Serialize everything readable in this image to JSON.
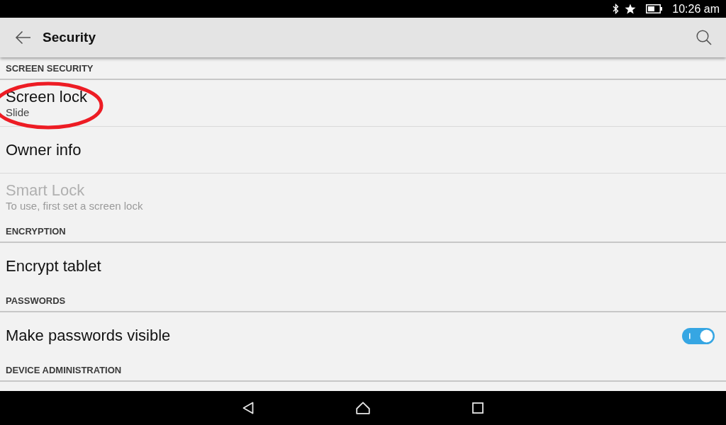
{
  "status_bar": {
    "time": "10:26 am"
  },
  "app_bar": {
    "title": "Security"
  },
  "sections": [
    {
      "title": "SCREEN SECURITY",
      "items": [
        {
          "kind": "text",
          "title": "Screen lock",
          "summary": "Slide",
          "disabled": false,
          "circled": true
        },
        {
          "kind": "text",
          "title": "Owner info",
          "disabled": false,
          "circled": false
        },
        {
          "kind": "text",
          "title": "Smart Lock",
          "summary": "To use, first set a screen lock",
          "disabled": true,
          "circled": false
        }
      ]
    },
    {
      "title": "ENCRYPTION",
      "items": [
        {
          "kind": "text",
          "title": "Encrypt tablet",
          "disabled": false,
          "circled": false
        }
      ]
    },
    {
      "title": "PASSWORDS",
      "items": [
        {
          "kind": "switch",
          "title": "Make passwords visible",
          "on": true,
          "disabled": false,
          "circled": false
        }
      ]
    },
    {
      "title": "DEVICE ADMINISTRATION"
    }
  ]
}
